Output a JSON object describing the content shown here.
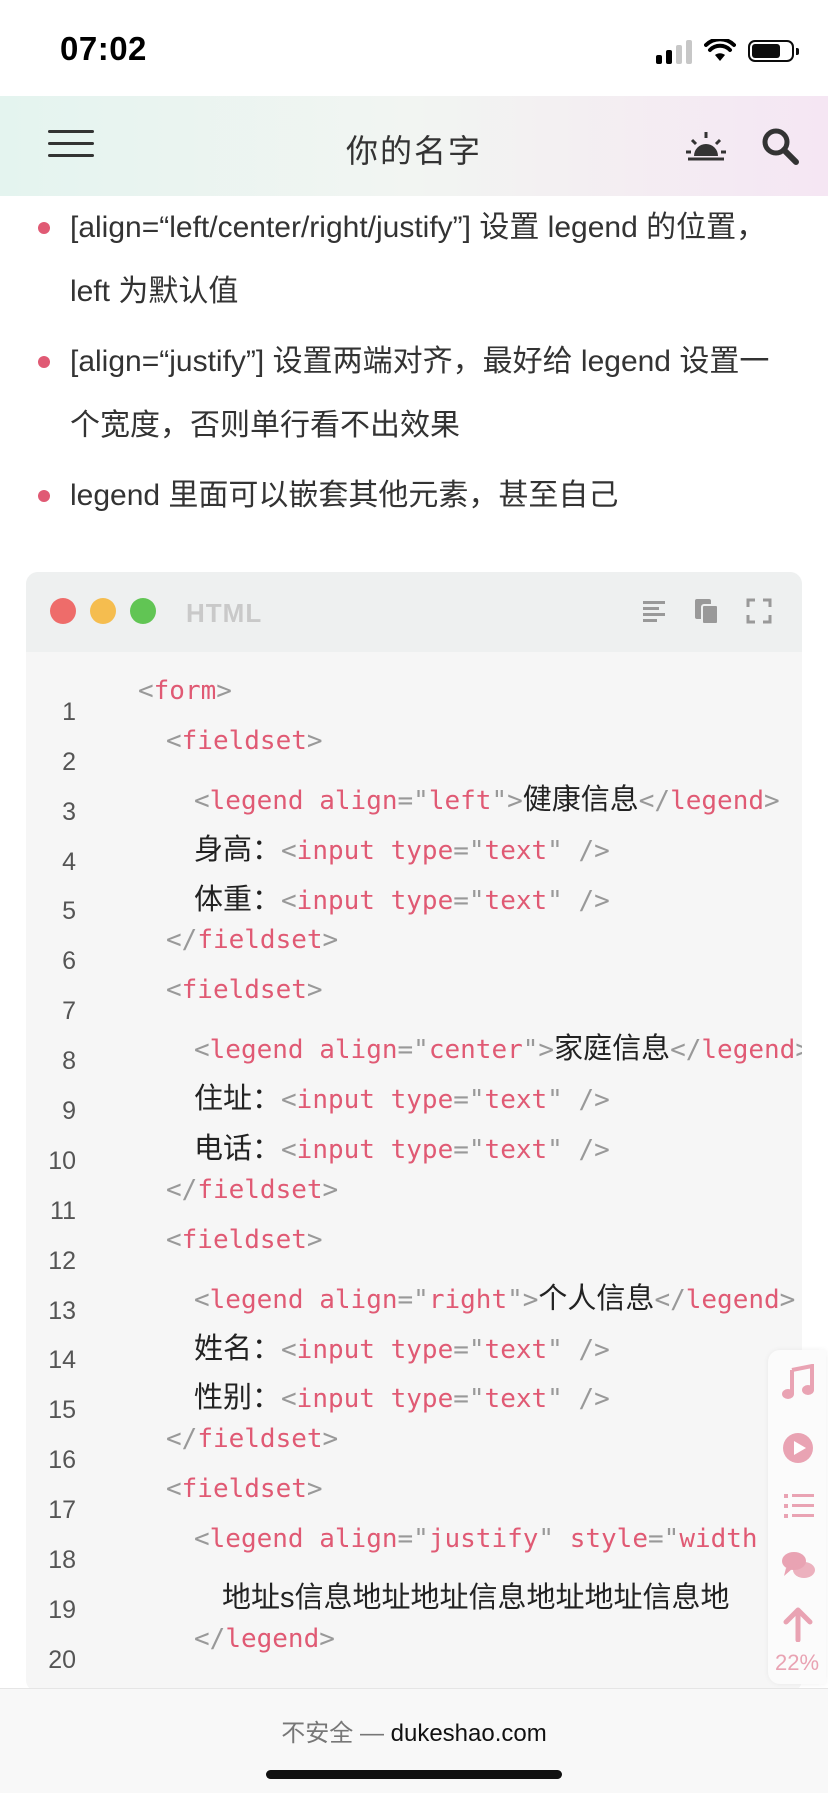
{
  "status": {
    "time": "07:02"
  },
  "header": {
    "title": "你的名字"
  },
  "article": {
    "bullets": [
      "[align=“left/center/right/justify”] 设置 legend 的位置，left 为默认值",
      "[align=“justify”] 设置两端对齐，最好给 legend 设置一个宽度，否则单行看不出效果",
      "legend 里面可以嵌套其他元素，甚至自己"
    ]
  },
  "code_block": {
    "language": "HTML",
    "line_numbers": [
      "1",
      "2",
      "3",
      "4",
      "5",
      "6",
      "7",
      "8",
      "9",
      "10",
      "11",
      "12",
      "13",
      "14",
      "15",
      "16",
      "17",
      "18",
      "19",
      "20"
    ],
    "texts": {
      "form": "form",
      "fieldset": "fieldset",
      "legend": "legend",
      "input": "input",
      "align": "align",
      "type": "type",
      "style": "style",
      "text": "text",
      "left": "left",
      "center": "center",
      "right": "right",
      "justify": "justify",
      "width": "width",
      "health": "健康信息",
      "height": "身高：",
      "weight": "体重：",
      "family": "家庭信息",
      "address": "住址：",
      "phone": "电话：",
      "personal": "个人信息",
      "name": "姓名：",
      "gender": "性别：",
      "long_address": "地址s信息地址地址信息地址地址信息地"
    }
  },
  "float_bar": {
    "scroll_percent": "22%"
  },
  "browser": {
    "insecure": "不安全 — ",
    "host": "dukeshao.com"
  }
}
